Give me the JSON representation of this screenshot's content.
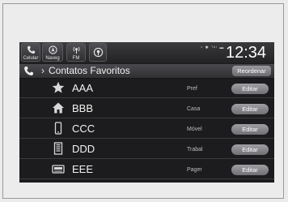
{
  "topbar": {
    "buttons": [
      {
        "label": "Celular",
        "icon": "phone-icon"
      },
      {
        "label": "Naveg",
        "icon": "navigation-icon"
      },
      {
        "label": "FM",
        "icon": "radio-icon"
      },
      {
        "label": "",
        "icon": "audio-source-icon"
      }
    ],
    "status_icons": "⁴ ✱ ᵀᵉˡ ▬",
    "clock": "12:34"
  },
  "header": {
    "title": "Contatos Favoritos",
    "reorder_label": "Reordenar"
  },
  "favorites": [
    {
      "name": "AAA",
      "type": "Pref",
      "icon": "star-icon",
      "edit_label": "Editar"
    },
    {
      "name": "BBB",
      "type": "Casa",
      "icon": "home-icon",
      "edit_label": "Editar"
    },
    {
      "name": "CCC",
      "type": "Móvel",
      "icon": "mobile-icon",
      "edit_label": "Editar"
    },
    {
      "name": "DDD",
      "type": "Trabal",
      "icon": "work-building-icon",
      "edit_label": "Editar"
    },
    {
      "name": "EEE",
      "type": "Pager",
      "icon": "pager-icon",
      "edit_label": "Editar"
    }
  ]
}
